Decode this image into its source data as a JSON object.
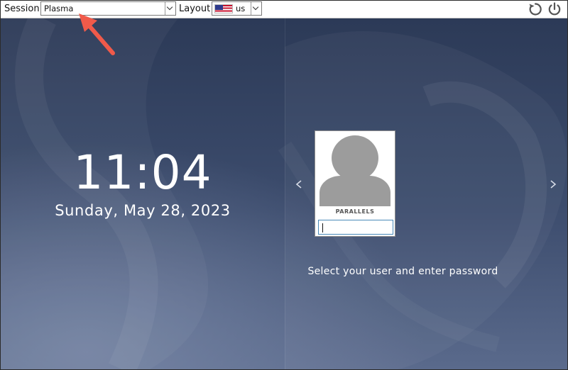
{
  "toolbar": {
    "session_label": "Session",
    "session_value": "Plasma",
    "layout_label": "Layout",
    "layout_value": "us",
    "flag_icon": "us-flag-icon",
    "restart_icon": "restart-icon",
    "power_icon": "power-icon"
  },
  "clock": {
    "time": "11:04",
    "date": "Sunday, May 28, 2023"
  },
  "user_card": {
    "username": "PARALLELS",
    "password_value": "",
    "avatar_icon": "user-avatar-icon"
  },
  "navigation": {
    "prev_icon": "chevron-left-icon",
    "next_icon": "chevron-right-icon"
  },
  "hint": "Select your user and enter password",
  "colors": {
    "annotation_arrow": "#f05a4a",
    "background": "#3a4a6a",
    "password_focus_border": "#4a8ab8"
  }
}
